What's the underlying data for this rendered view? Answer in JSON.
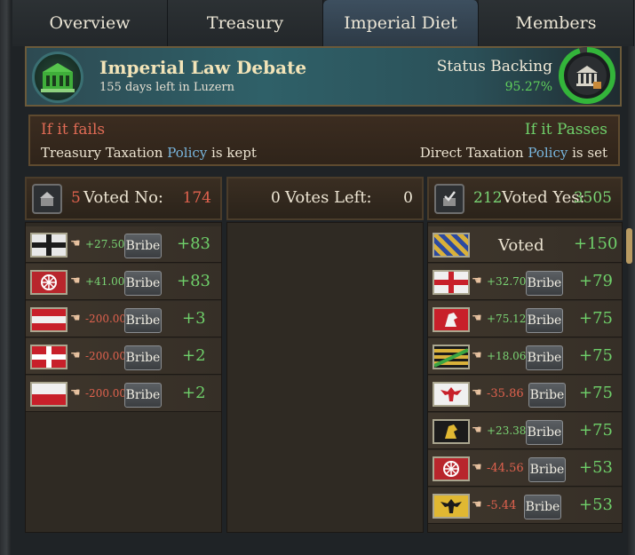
{
  "tabs": [
    {
      "label": "Overview"
    },
    {
      "label": "Treasury"
    },
    {
      "label": "Imperial Diet"
    },
    {
      "label": "Members"
    }
  ],
  "header": {
    "title": "Imperial Law Debate",
    "subtitle": "155 days left in Luzern",
    "status_label": "Status Backing",
    "status_value": "95.27%",
    "status_fraction": 0.9527
  },
  "outcome": {
    "fail_label": "If it fails",
    "fail_prefix": "Treasury Taxation",
    "fail_policy": "Policy",
    "fail_suffix": "is kept",
    "pass_label": "If it Passes",
    "pass_prefix": "Direct Taxation",
    "pass_policy": "Policy",
    "pass_suffix": "is set"
  },
  "no_column": {
    "count": "5",
    "label": "Voted No:",
    "total": "174",
    "rows": [
      {
        "flag": "black-cross",
        "modifier": "+27.50",
        "bribe": "Bribe",
        "weight": "+83"
      },
      {
        "flag": "wheel",
        "modifier": "+41.00",
        "bribe": "Bribe",
        "weight": "+83"
      },
      {
        "flag": "red-white-red",
        "modifier": "-200.00",
        "bribe": "Bribe",
        "weight": "+3"
      },
      {
        "flag": "white-cross-red",
        "modifier": "-200.00",
        "bribe": "Bribe",
        "weight": "+2"
      },
      {
        "flag": "white-red",
        "modifier": "-200.00",
        "bribe": "Bribe",
        "weight": "+2"
      }
    ]
  },
  "left_column": {
    "count": "0",
    "label": "Votes Left:",
    "total": "0"
  },
  "yes_column": {
    "count": "212",
    "label": "Voted Yes:",
    "total": "3505",
    "first": {
      "flag": "blue-gold-bend",
      "status": "Voted",
      "weight": "+150"
    },
    "rows": [
      {
        "flag": "red-cross",
        "modifier": "+32.70",
        "bribe": "Bribe",
        "weight": "+79"
      },
      {
        "flag": "red-lion",
        "modifier": "+75.12",
        "bribe": "Bribe",
        "weight": "+75"
      },
      {
        "flag": "saxony",
        "modifier": "+18.06",
        "bribe": "Bribe",
        "weight": "+75"
      },
      {
        "flag": "red-eagle",
        "modifier": "-35.86",
        "bribe": "Bribe",
        "weight": "+75"
      },
      {
        "flag": "gold-lion",
        "modifier": "+23.38",
        "bribe": "Bribe",
        "weight": "+75"
      },
      {
        "flag": "wheel",
        "modifier": "-44.56",
        "bribe": "Bribe",
        "weight": "+53"
      },
      {
        "flag": "black-eagle",
        "modifier": "-5.44",
        "bribe": "Bribe",
        "weight": "+53"
      }
    ]
  },
  "colors": {
    "positive": "#6fd06a",
    "negative": "#e0624e",
    "policy_link": "#79b6de"
  }
}
